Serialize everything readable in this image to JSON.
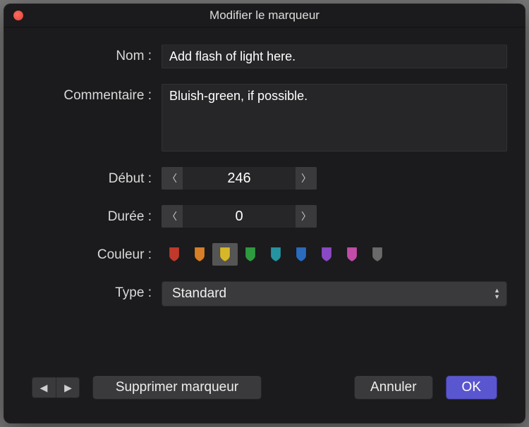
{
  "window": {
    "title": "Modifier le marqueur"
  },
  "fields": {
    "name_label": "Nom :",
    "name_value": "Add flash of light here.",
    "comment_label": "Commentaire :",
    "comment_value": "Bluish-green, if possible.",
    "start_label": "Début :",
    "start_value": "246",
    "duration_label": "Durée :",
    "duration_value": "0",
    "color_label": "Couleur :",
    "type_label": "Type :",
    "type_value": "Standard"
  },
  "colors": {
    "options": [
      {
        "name": "red",
        "hex": "#c0392b"
      },
      {
        "name": "orange",
        "hex": "#d67f28"
      },
      {
        "name": "yellow",
        "hex": "#d6b728"
      },
      {
        "name": "green",
        "hex": "#2e9a3f"
      },
      {
        "name": "teal",
        "hex": "#2594a0"
      },
      {
        "name": "blue",
        "hex": "#2a6bbd"
      },
      {
        "name": "purple",
        "hex": "#8a49c4"
      },
      {
        "name": "magenta",
        "hex": "#c04da8"
      },
      {
        "name": "gray",
        "hex": "#6a6a6a"
      }
    ],
    "selected_index": 2
  },
  "footer": {
    "delete_label": "Supprimer marqueur",
    "cancel_label": "Annuler",
    "ok_label": "OK"
  }
}
